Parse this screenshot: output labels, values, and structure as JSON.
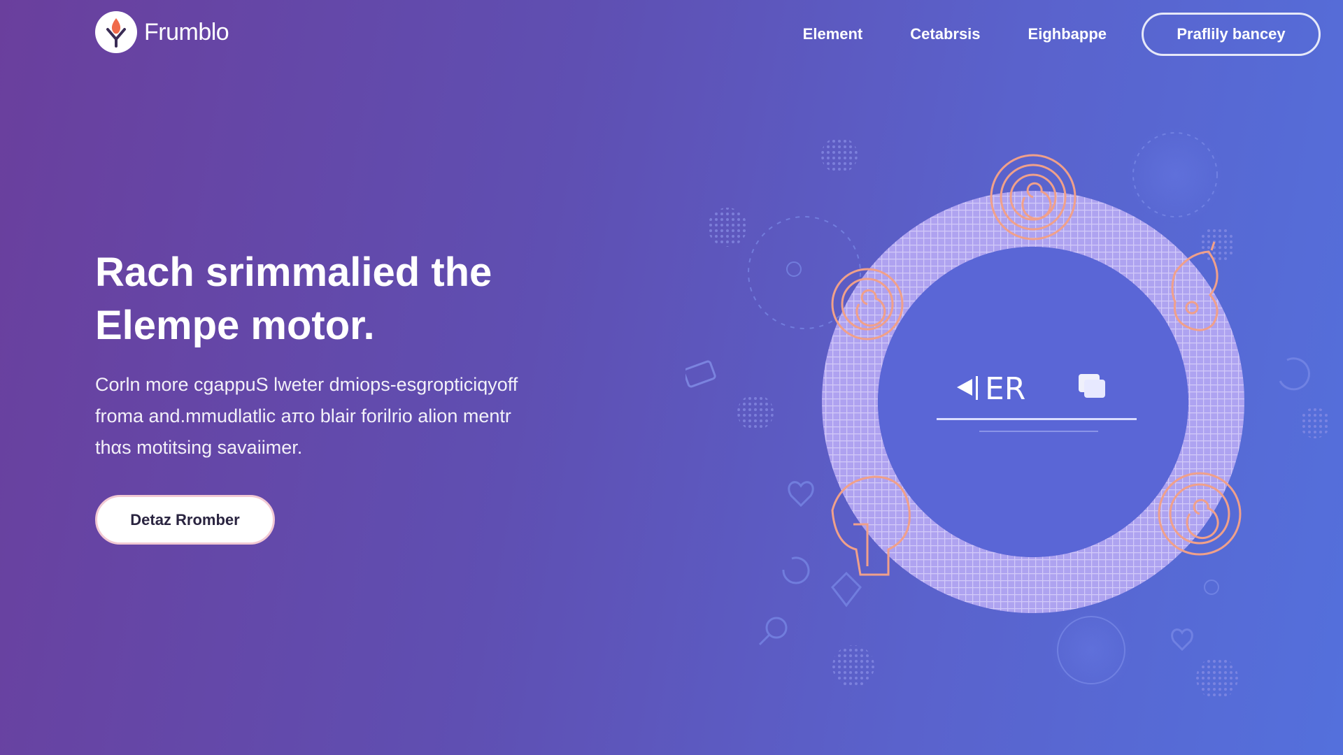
{
  "header": {
    "logo_text": "Frumblo",
    "nav_items": [
      {
        "label": "Element"
      },
      {
        "label": "Cetabrsis"
      },
      {
        "label": "Eighbappe"
      }
    ],
    "cta_label": "Praflily bancey"
  },
  "hero": {
    "title_line1": "Rach srimmalied the",
    "title_line2": "Elempe motor.",
    "body_line1": "Corln more cgappuS lweter dmiops-esgropticiqyoff",
    "body_line2": "froma and.mmudlatlic aπo blair forilrio alion mentr",
    "body_line3": "thαs motitsing savaiimer.",
    "cta_label": "Detaz Rromber"
  },
  "illustration": {
    "screen_label": "ER",
    "icons": [
      "play-icon",
      "copy-icon",
      "spiral-icon",
      "head-profile-icon",
      "dotted-sphere-icon"
    ]
  },
  "colors": {
    "bg_start": "#6a3f9d",
    "bg_end": "#5470dc",
    "accent_peach": "#f0a08a",
    "ring": "#a9a8f5"
  }
}
